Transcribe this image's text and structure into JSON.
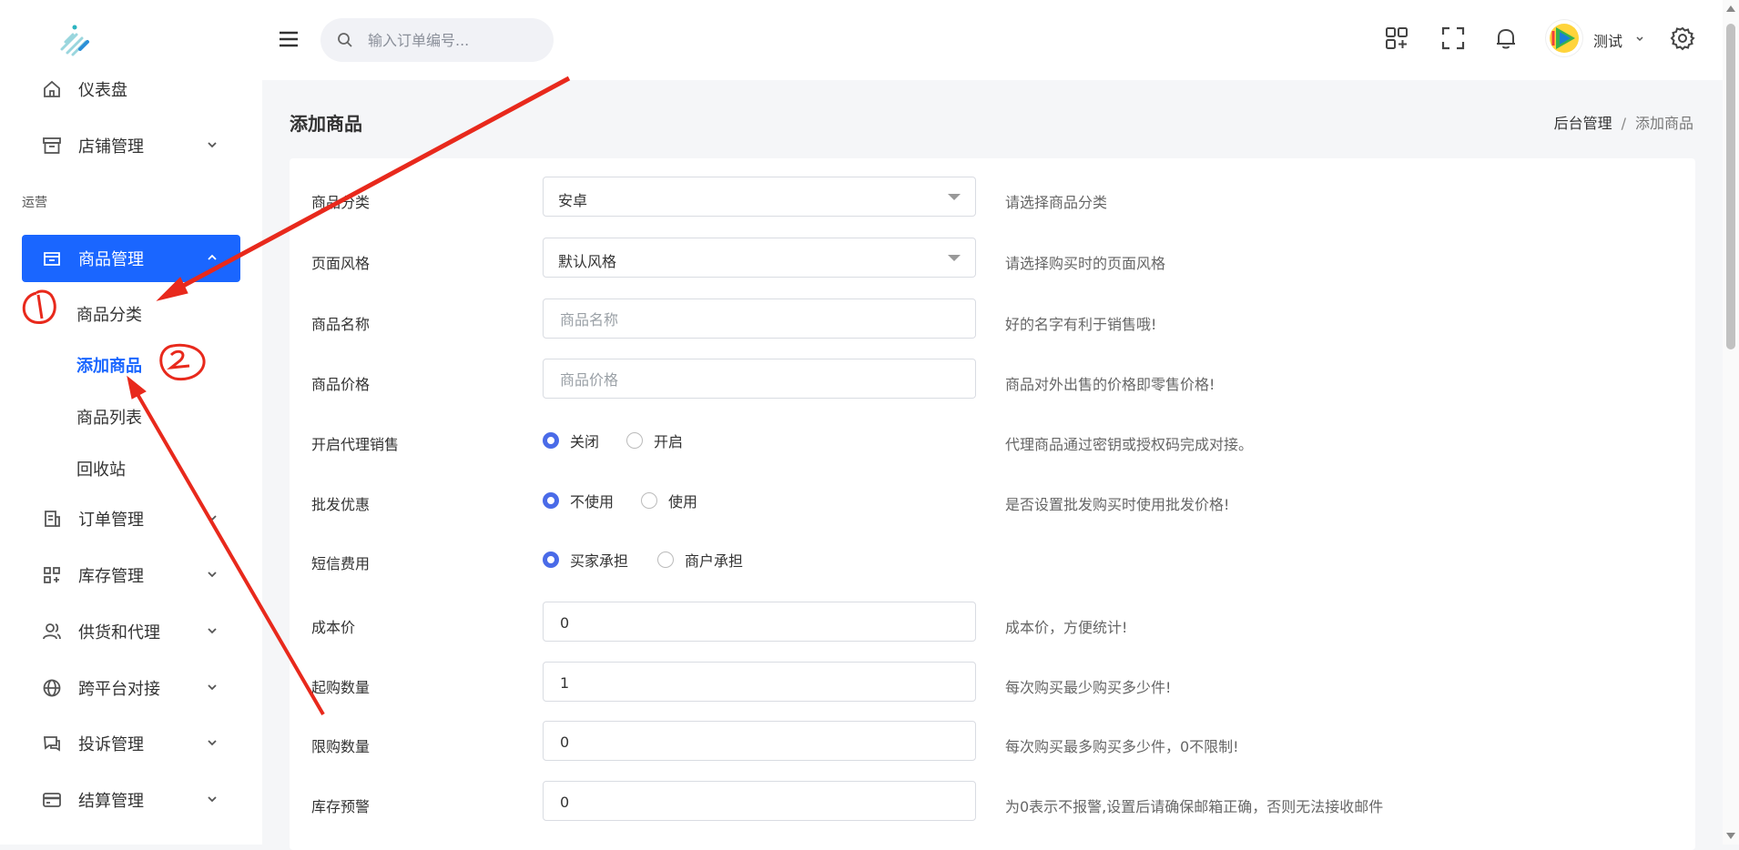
{
  "sidebar": {
    "items_top": [
      {
        "label": "仪表盘",
        "icon": "home-icon"
      },
      {
        "label": "店铺管理",
        "icon": "store-icon"
      }
    ],
    "section": "运营",
    "active": {
      "label": "商品管理",
      "icon": "goods-box-icon"
    },
    "sub_items": [
      "商品分类",
      "添加商品",
      "商品列表",
      "回收站"
    ],
    "items_bottom": [
      {
        "label": "订单管理",
        "icon": "order-icon"
      },
      {
        "label": "库存管理",
        "icon": "inventory-icon"
      },
      {
        "label": "供货和代理",
        "icon": "users-icon"
      },
      {
        "label": "跨平台对接",
        "icon": "globe-icon"
      },
      {
        "label": "投诉管理",
        "icon": "complaint-icon"
      },
      {
        "label": "结算管理",
        "icon": "card-icon"
      }
    ]
  },
  "header": {
    "search_placeholder": "输入订单编号...",
    "username": "测试"
  },
  "page": {
    "title": "添加商品",
    "breadcrumb": [
      "后台管理",
      "/",
      "添加商品"
    ]
  },
  "form": {
    "category": {
      "label": "商品分类",
      "value": "安卓",
      "hint": "请选择商品分类"
    },
    "style": {
      "label": "页面风格",
      "value": "默认风格",
      "hint": "请选择购买时的页面风格"
    },
    "name": {
      "label": "商品名称",
      "placeholder": "商品名称",
      "hint": "好的名字有利于销售哦!"
    },
    "price": {
      "label": "商品价格",
      "placeholder": "商品价格",
      "hint": "商品对外出售的价格即零售价格!"
    },
    "agent": {
      "label": "开启代理销售",
      "opt1": "关闭",
      "opt2": "开启",
      "hint": "代理商品通过密钥或授权码完成对接。"
    },
    "wholesale": {
      "label": "批发优惠",
      "opt1": "不使用",
      "opt2": "使用",
      "hint": "是否设置批发购买时使用批发价格!"
    },
    "sms": {
      "label": "短信费用",
      "opt1": "买家承担",
      "opt2": "商户承担"
    },
    "cost": {
      "label": "成本价",
      "value": "0",
      "hint": "成本价，方便统计!"
    },
    "min_qty": {
      "label": "起购数量",
      "value": "1",
      "hint": "每次购买最少购买多少件!"
    },
    "max_qty": {
      "label": "限购数量",
      "value": "0",
      "hint": "每次购买最多购买多少件，0不限制!"
    },
    "stock_alert": {
      "label": "库存预警",
      "value": "0",
      "hint": "为0表示不报警,设置后请确保邮箱正确，否则无法接收邮件"
    }
  },
  "colors": {
    "accent": "#1a66ff",
    "radio": "#4a6be8",
    "annotation": "#e8291c"
  }
}
